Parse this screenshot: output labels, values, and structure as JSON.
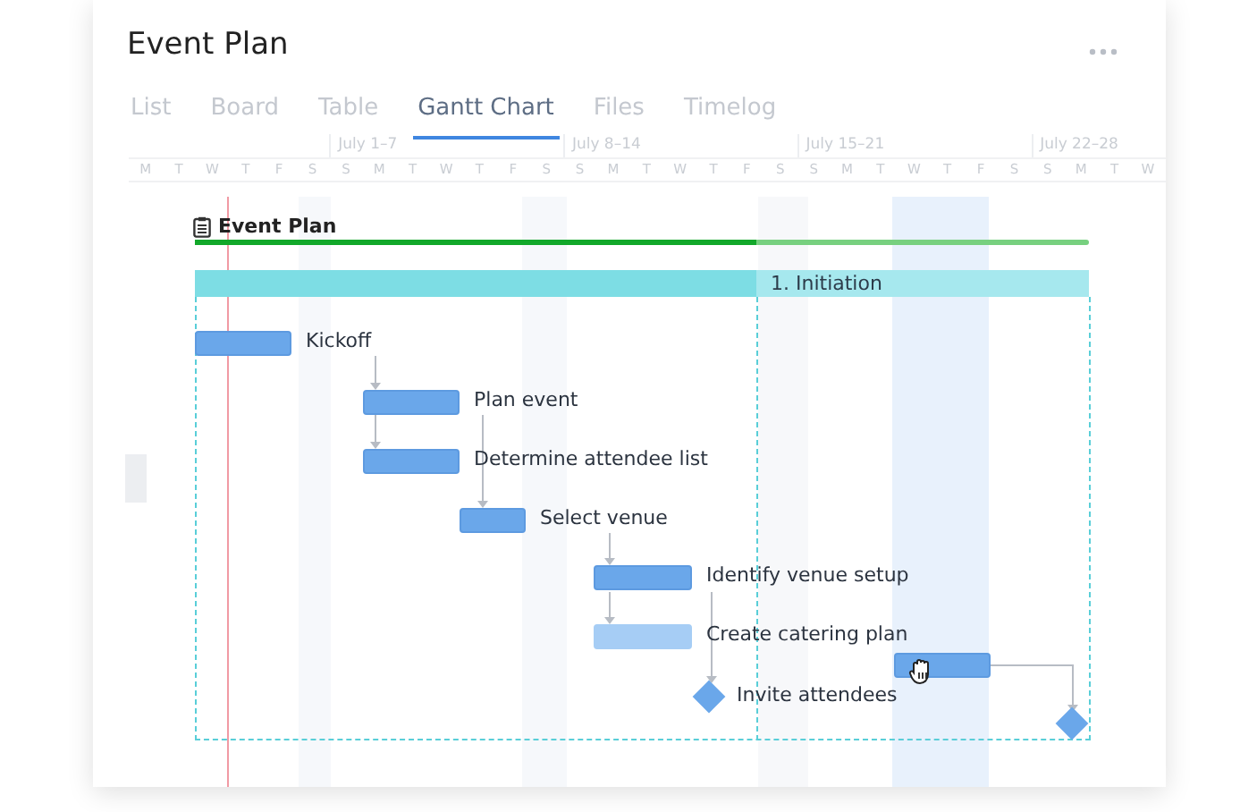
{
  "title": "Event Plan",
  "tabs": [
    {
      "label": "List",
      "selected": false
    },
    {
      "label": "Board",
      "selected": false
    },
    {
      "label": "Table",
      "selected": false
    },
    {
      "label": "Gantt Chart",
      "selected": true
    },
    {
      "label": "Files",
      "selected": false
    },
    {
      "label": "Timelog",
      "selected": false
    }
  ],
  "weeks": [
    "July 1–7",
    "July 8–14",
    "July 15–21",
    "July 22–28"
  ],
  "days": [
    "M",
    "T",
    "W",
    "T",
    "F",
    "S",
    "S",
    "M",
    "T",
    "W",
    "T",
    "F",
    "S",
    "S",
    "M",
    "T",
    "W",
    "T",
    "F",
    "S",
    "S",
    "M",
    "T",
    "W",
    "T",
    "F",
    "S",
    "S",
    "M",
    "T",
    "W"
  ],
  "project": {
    "name": "Event Plan"
  },
  "phase": {
    "name": "1. Initiation"
  },
  "tasks": [
    {
      "name": "Kickoff",
      "kind": "bar"
    },
    {
      "name": "Plan event",
      "kind": "bar"
    },
    {
      "name": "Determine attendee list",
      "kind": "bar"
    },
    {
      "name": "Select venue",
      "kind": "bar"
    },
    {
      "name": "Identify venue setup",
      "kind": "bar"
    },
    {
      "name": "Create catering plan",
      "kind": "bar-light"
    },
    {
      "name": "Invite attendees",
      "kind": "milestone"
    },
    {
      "kind": "bar-drag"
    },
    {
      "kind": "milestone"
    }
  ]
}
